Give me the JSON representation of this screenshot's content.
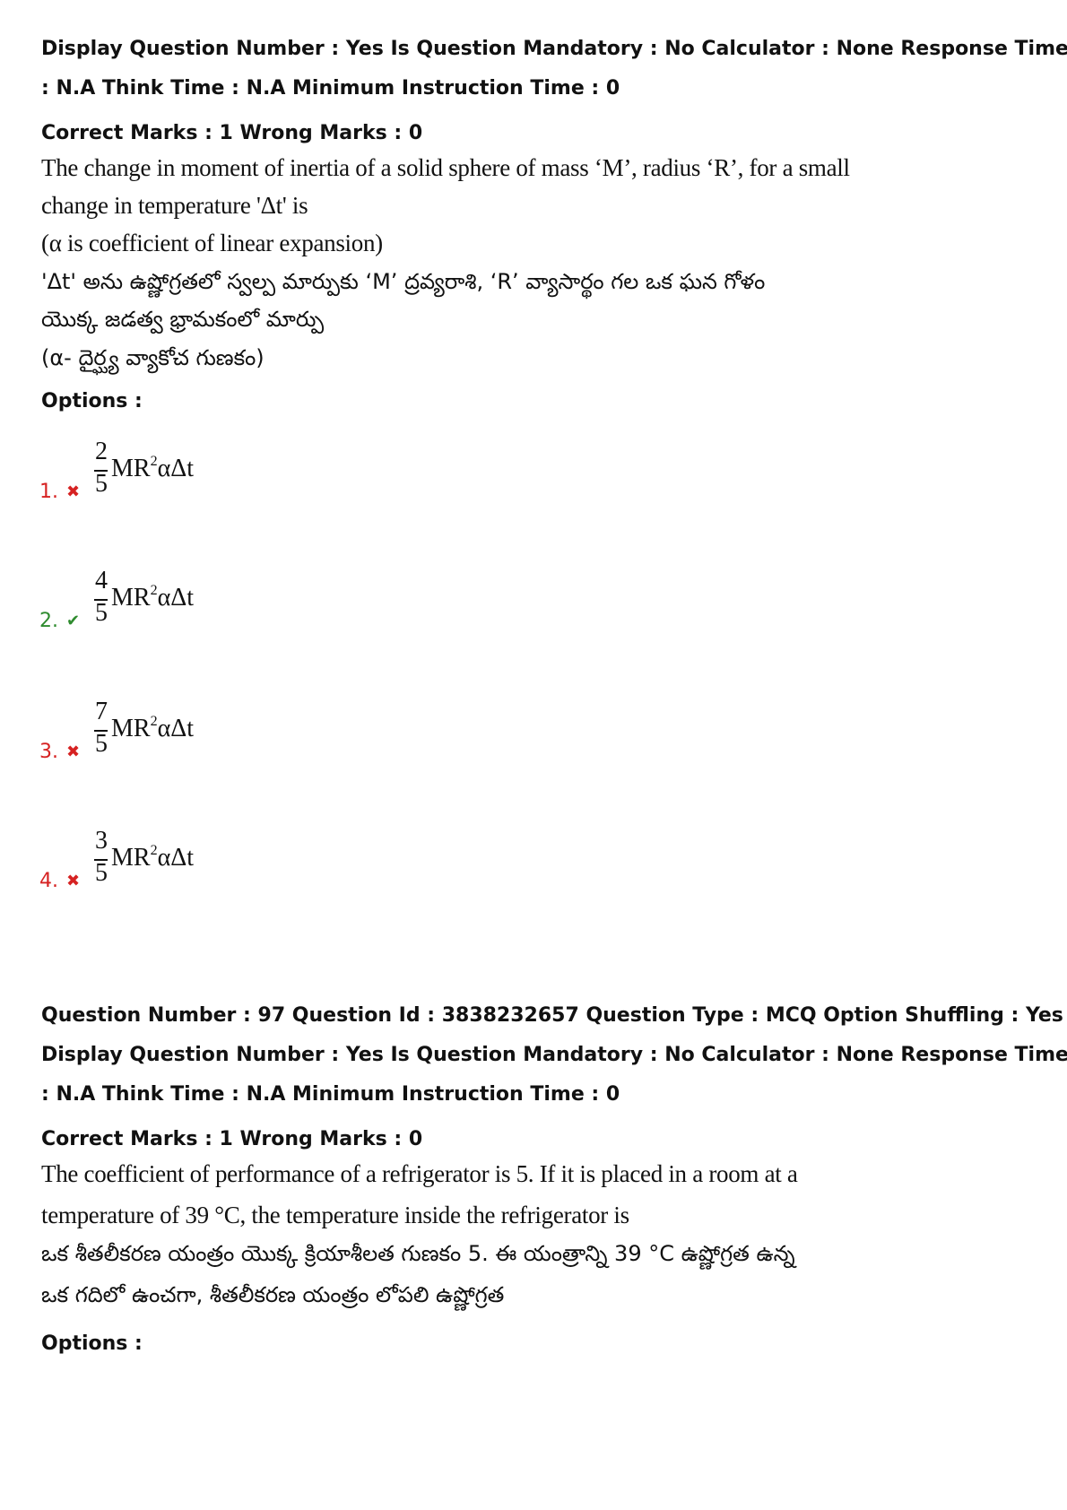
{
  "q96": {
    "meta_line1": "Display Question Number : Yes Is Question Mandatory : No Calculator : None Response Time",
    "meta_line2": ": N.A Think Time : N.A Minimum Instruction Time : 0",
    "marks": "Correct Marks : 1 Wrong Marks : 0",
    "en_line1": "The change in moment of inertia of a solid sphere of mass ‘M’, radius ‘R’, for a small",
    "en_line2": "change in temperature 'Δt' is",
    "en_line3": "(α is coefficient of linear expansion)",
    "te_line1": "'Δt' అను ఉష్ణోగ్రతలో స్వల్ప మార్పుకు ‘M’ ద్రవ్యరాశి, ‘R’ వ్యాసార్థం గల ఒక ఘన గోళం",
    "te_line2": "యొక్క జడత్వ భ్రామకంలో మార్పు",
    "te_line3": "(α- దైర్ఘ్య వ్యాకోచ గుణకం)",
    "options_label": "Options :",
    "options": [
      {
        "num": "1.",
        "status": "wrong",
        "icon": "cross-icon",
        "symbol": "✖",
        "numerator": "2",
        "denominator": "5",
        "expr_base": "MR",
        "expr_sup": "2",
        "expr_tail": "αΔt"
      },
      {
        "num": "2.",
        "status": "correct",
        "icon": "check-icon",
        "symbol": "✔",
        "numerator": "4",
        "denominator": "5",
        "expr_base": "MR",
        "expr_sup": "2",
        "expr_tail": "αΔt"
      },
      {
        "num": "3.",
        "status": "wrong",
        "icon": "cross-icon",
        "symbol": "✖",
        "numerator": "7",
        "denominator": "5",
        "expr_base": "MR",
        "expr_sup": "2",
        "expr_tail": "αΔt"
      },
      {
        "num": "4.",
        "status": "wrong",
        "icon": "cross-icon",
        "symbol": "✖",
        "numerator": "3",
        "denominator": "5",
        "expr_base": "MR",
        "expr_sup": "2",
        "expr_tail": "αΔt"
      }
    ]
  },
  "q97": {
    "meta_line1": "Question Number : 97 Question Id : 3838232657 Question Type : MCQ Option Shuffling : Yes",
    "meta_line2": "Display Question Number : Yes Is Question Mandatory : No Calculator : None Response Time",
    "meta_line3": ": N.A Think Time : N.A Minimum Instruction Time : 0",
    "marks": "Correct Marks : 1 Wrong Marks : 0",
    "en_line1": "The coefficient of performance of a refrigerator is 5.  If it is placed in a room at a",
    "en_line2": "temperature of 39 °C, the temperature inside the refrigerator is",
    "te_line1": "ఒక శీతలీకరణ యంత్రం యొక్క క్రియాశీలత గుణకం 5. ఈ యంత్రాన్ని 39 °C ఉష్ణోగ్రత ఉన్న",
    "te_line2": "ఒక గదిలో ఉంచగా, శీతలీకరణ యంత్రం లోపలి ఉష్ణోగ్రత",
    "options_label": "Options :"
  },
  "colors": {
    "wrong": "#d62222",
    "correct": "#2e8b2e"
  }
}
